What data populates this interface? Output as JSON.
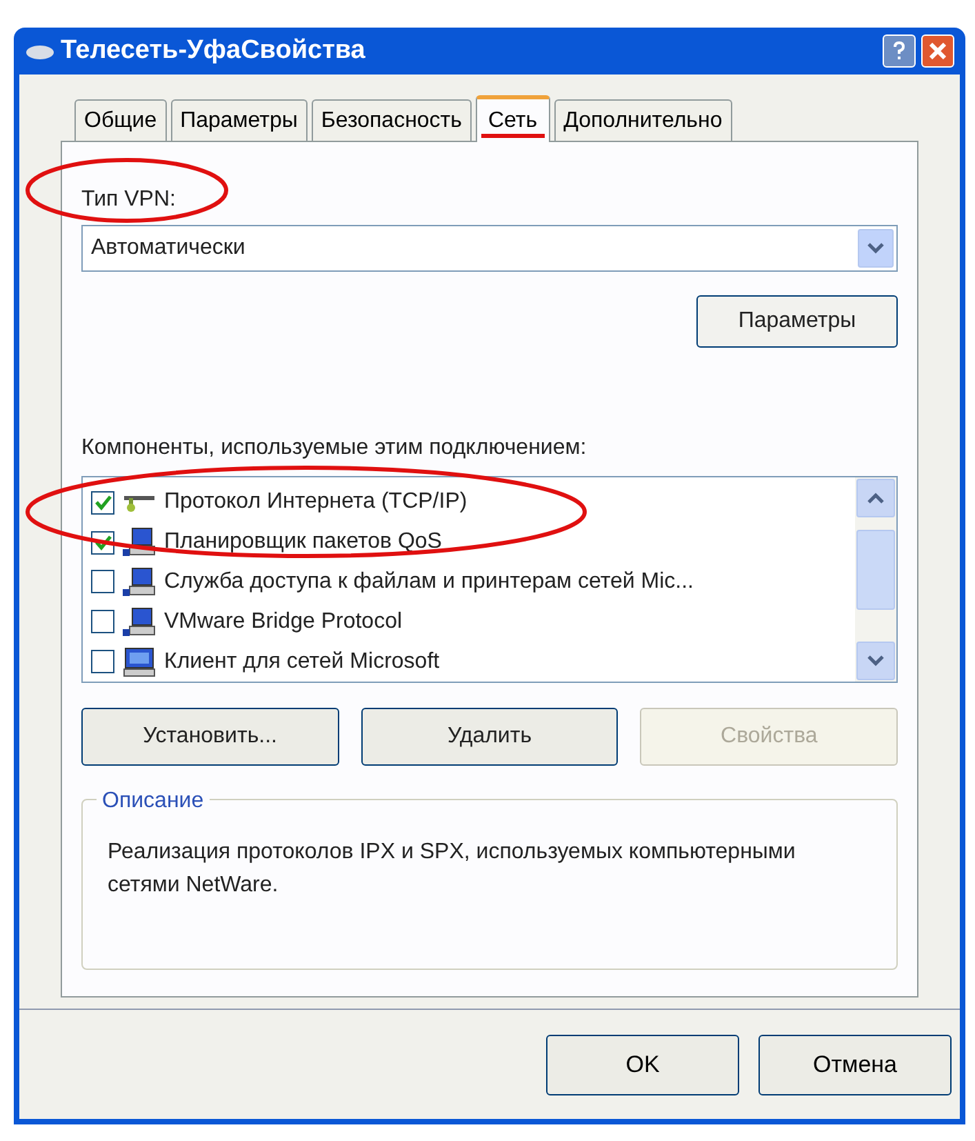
{
  "window": {
    "title": "Телесеть-УфаСвойства"
  },
  "tabs": [
    {
      "label": "Общие",
      "selected": false
    },
    {
      "label": "Параметры",
      "selected": false
    },
    {
      "label": "Безопасность",
      "selected": false
    },
    {
      "label": "Сеть",
      "selected": true
    },
    {
      "label": "Дополнительно",
      "selected": false
    }
  ],
  "vpn_type": {
    "label": "Тип VPN:",
    "value": "Автоматически"
  },
  "settings_button": "Параметры",
  "components": {
    "label": "Компоненты, используемые этим подключением:",
    "items": [
      {
        "label": "Протокол Интернета (TCP/IP)",
        "checked": true,
        "kind": "protocol"
      },
      {
        "label": "Планировщик пакетов QoS",
        "checked": true,
        "kind": "service"
      },
      {
        "label": "Служба доступа к файлам и принтерам сетей Mic...",
        "checked": false,
        "kind": "service"
      },
      {
        "label": "VMware Bridge Protocol",
        "checked": false,
        "kind": "service"
      },
      {
        "label": "Клиент для сетей Microsoft",
        "checked": false,
        "kind": "client"
      }
    ]
  },
  "component_buttons": [
    {
      "label": "Установить...",
      "disabled": false
    },
    {
      "label": "Удалить",
      "disabled": false
    },
    {
      "label": "Свойства",
      "disabled": true
    }
  ],
  "description": {
    "title": "Описание",
    "text": "Реализация протоколов IPX и SPX, используемых компьютерными сетями NetWare."
  },
  "dialog_buttons": [
    "OK",
    "Отмена"
  ]
}
